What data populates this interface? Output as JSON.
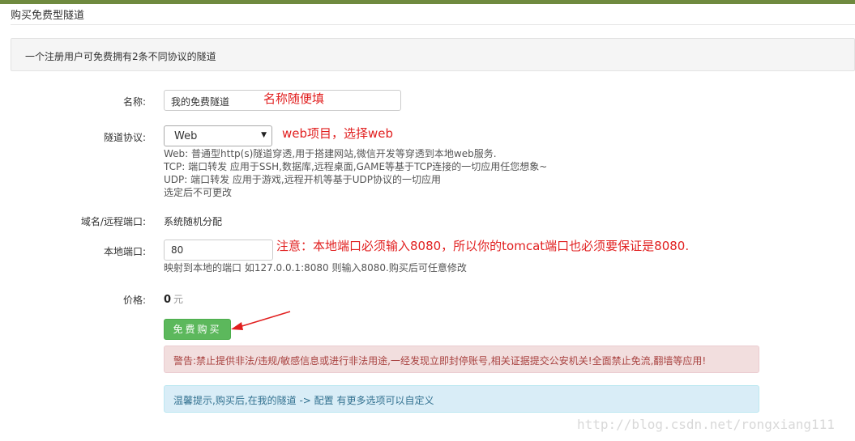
{
  "page": {
    "title": "购买免费型隧道",
    "info_text": "一个注册用户可免费拥有2条不同协议的隧道"
  },
  "form": {
    "name": {
      "label": "名称:",
      "value": "我的免费隧道",
      "annotation": "名称随便填"
    },
    "protocol": {
      "label": "隧道协议:",
      "selected": "Web",
      "annotation": "web项目，选择web",
      "help": [
        "Web: 普通型http(s)隧道穿透,用于搭建网站,微信开发等穿透到本地web服务.",
        "TCP: 端口转发 应用于SSH,数据库,远程桌面,GAME等基于TCP连接的一切应用任您想象~",
        "UDP: 端口转发 应用于游戏,远程开机等基于UDP协议的一切应用",
        "选定后不可更改"
      ]
    },
    "domain": {
      "label": "域名/远程端口:",
      "value": "系统随机分配"
    },
    "local_port": {
      "label": "本地端口:",
      "value": "80",
      "annotation": "注意：本地端口必须输入8080，所以你的tomcat端口也必须要保证是8080.",
      "help": "映射到本地的端口 如127.0.0.1:8080 则输入8080.购买后可任意修改"
    },
    "price": {
      "label": "价格:",
      "value": "0",
      "unit": "元"
    },
    "buy_label": "免费购买"
  },
  "alerts": {
    "warning": "警告:禁止提供非法/违规/敏感信息或进行非法用途,一经发现立即封停账号,相关证据提交公安机关!全面禁止免流,翻墙等应用!",
    "tip": "温馨提示,购买后,在我的隧道 -> 配置 有更多选项可以自定义"
  },
  "watermark": "http://blog.csdn.net/rongxiang111",
  "colors": {
    "annotation_red": "#e11f1f",
    "buy_button": "#5cb85c",
    "topbar": "#6f8a3f"
  },
  "icons": {
    "select_arrow": "chevron-down-icon",
    "annotation_arrow": "red-arrow-icon"
  }
}
